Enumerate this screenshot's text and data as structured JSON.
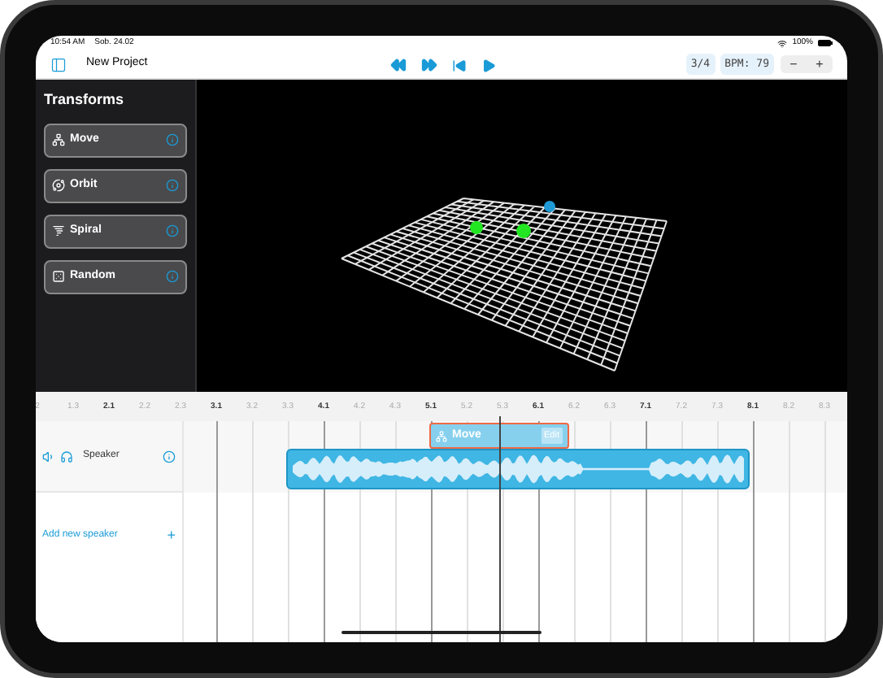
{
  "status_bar": {
    "time": "10:54 AM",
    "date": "Sob. 24.02",
    "battery": "100%"
  },
  "toolbar": {
    "title": "New Project",
    "time_signature": "3/4",
    "bpm": "BPM: 79",
    "stepper": [
      "−",
      "+"
    ]
  },
  "transforms": {
    "title": "Transforms",
    "items": [
      {
        "label": "Move",
        "kind": "move"
      },
      {
        "label": "Orbit",
        "kind": "orbit"
      },
      {
        "label": "Spiral",
        "kind": "spiral"
      },
      {
        "label": "Random",
        "kind": "random"
      }
    ]
  },
  "timeline": {
    "ruler": [
      {
        "label": "2",
        "major": false
      },
      {
        "label": "1.3",
        "major": false
      },
      {
        "label": "2.1",
        "major": true
      },
      {
        "label": "2.2",
        "major": false
      },
      {
        "label": "2.3",
        "major": false
      },
      {
        "label": "3.1",
        "major": true
      },
      {
        "label": "3.2",
        "major": false
      },
      {
        "label": "3.3",
        "major": false
      },
      {
        "label": "4.1",
        "major": true
      },
      {
        "label": "4.2",
        "major": false
      },
      {
        "label": "4.3",
        "major": false
      },
      {
        "label": "5.1",
        "major": true
      },
      {
        "label": "5.2",
        "major": false
      },
      {
        "label": "5.3",
        "major": false
      },
      {
        "label": "6.1",
        "major": true
      },
      {
        "label": "6.2",
        "major": false
      },
      {
        "label": "6.3",
        "major": false
      },
      {
        "label": "7.1",
        "major": true
      },
      {
        "label": "7.2",
        "major": false
      },
      {
        "label": "7.3",
        "major": false
      },
      {
        "label": "8.1",
        "major": true
      },
      {
        "label": "8.2",
        "major": false
      },
      {
        "label": "8.3",
        "major": false
      }
    ],
    "tracks": [
      {
        "name": "Speaker"
      }
    ],
    "add_speaker": {
      "label": "Add new speaker",
      "icon": "+"
    },
    "transform_clip": {
      "label": "Move",
      "edit": "Edit",
      "selected": true
    }
  }
}
